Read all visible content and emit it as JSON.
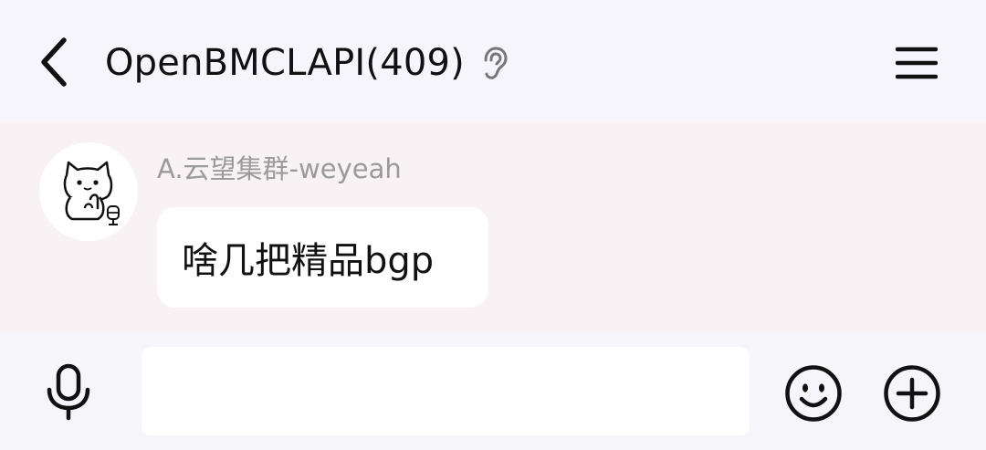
{
  "header": {
    "title": "OpenBMCLAPI(409)",
    "back_icon": "chevron-left-icon",
    "ear_icon": "ear-icon",
    "menu_icon": "hamburger-menu-icon"
  },
  "messages": [
    {
      "sender": "A.云望集群-weyeah",
      "text": "啥几把精品bgp",
      "avatar": "cat-avatar"
    }
  ],
  "input_bar": {
    "placeholder": "",
    "value": "",
    "mic_icon": "microphone-icon",
    "emoji_icon": "smiley-icon",
    "plus_icon": "plus-circle-icon"
  },
  "colors": {
    "header_bg": "#f5f5fb",
    "chat_bg": "#f8f2f5",
    "bubble_bg": "#ffffff",
    "sender_text": "#9a9a9a"
  }
}
